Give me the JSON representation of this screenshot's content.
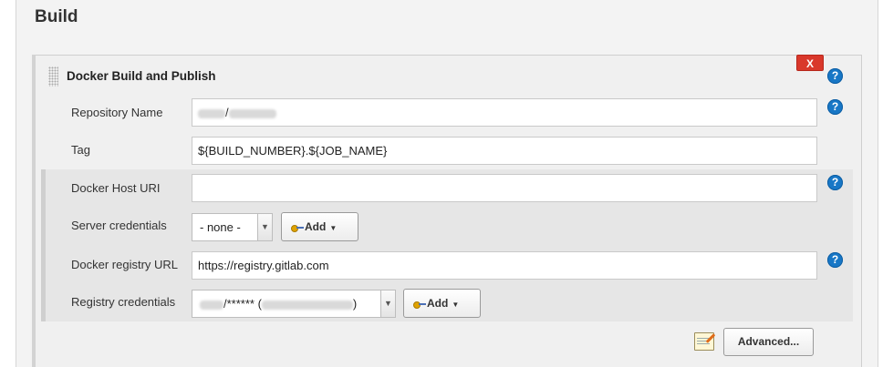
{
  "section": {
    "title": "Build"
  },
  "builder": {
    "title": "Docker Build and Publish",
    "delete_label": "X",
    "help_label": "?"
  },
  "fields": {
    "repository_name": {
      "label": "Repository Name",
      "separator": "/"
    },
    "tag": {
      "label": "Tag",
      "value": "${BUILD_NUMBER}.${JOB_NAME}"
    },
    "docker_host_uri": {
      "label": "Docker Host URI",
      "value": ""
    },
    "server_credentials": {
      "label": "Server credentials",
      "selected": "- none -",
      "add_label": "Add"
    },
    "docker_registry_url": {
      "label": "Docker registry URL",
      "value": "https://registry.gitlab.com"
    },
    "registry_credentials": {
      "label": "Registry credentials",
      "selected_middle": "/****** (",
      "selected_suffix": ")",
      "add_label": "Add"
    }
  },
  "actions": {
    "advanced_label": "Advanced..."
  },
  "colors": {
    "help_blue": "#1877c6",
    "delete_red": "#d9382b",
    "panel_bg": "#f0f0f0"
  },
  "icons": [
    "drag-handle-icon",
    "help-icon",
    "key-icon",
    "chevron-down-icon",
    "notepad-icon"
  ]
}
